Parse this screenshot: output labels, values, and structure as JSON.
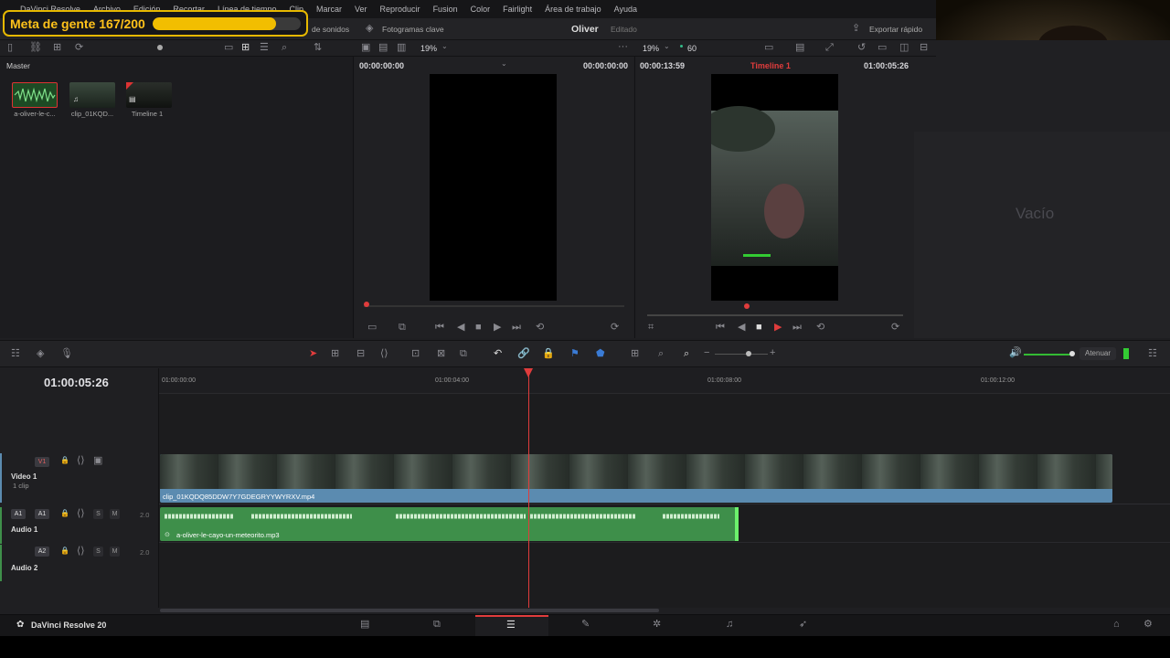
{
  "menu": {
    "items": [
      "DaVinci Resolve",
      "Archivo",
      "Edición",
      "Recortar",
      "Línea de tiempo",
      "Clip",
      "Marcar",
      "Ver",
      "Reproducir",
      "Fusion",
      "Color",
      "Fairlight",
      "Área de trabajo",
      "Ayuda"
    ]
  },
  "goal": {
    "label": "Meta de gente 167/200",
    "progress": 0.835
  },
  "toolbar": {
    "sounds_label": "de sonidos",
    "keyframes_label": "Fotogramas clave",
    "project_name": "Oliver",
    "project_status": "Editado",
    "export_label": "Exportar rápido"
  },
  "media_pool": {
    "title": "Master",
    "clips": [
      {
        "name": "a-oliver-le-c...",
        "type": "audio"
      },
      {
        "name": "clip_01KQD...",
        "type": "video"
      },
      {
        "name": "Timeline 1",
        "type": "timeline"
      }
    ]
  },
  "source_viewer": {
    "zoom": "19%",
    "tc_left": "00:00:00:00",
    "tc_right": "00:00:00:00"
  },
  "program_viewer": {
    "zoom": "19%",
    "fps": "60",
    "duration": "00:00:13:59",
    "timeline_name": "Timeline 1",
    "tc": "01:00:05:26"
  },
  "inspector": {
    "empty_label": "Vacío"
  },
  "timeline": {
    "current_tc": "01:00:05:26",
    "ruler": [
      "01:00:00:00",
      "01:00:04:00",
      "01:00:08:00",
      "01:00:12:00"
    ],
    "dim_label": "Atenuar",
    "tracks": [
      {
        "tag": "V1",
        "name": "Video 1",
        "sub": "1 clip",
        "clip": "clip_01KQDQ85DDW7Y7GDEGRYYWYRXV.mp4"
      },
      {
        "tag": "A1",
        "tag2": "A1",
        "name": "Audio 1",
        "level": "2.0",
        "clip": "a-oliver-le-cayo-un-meteorito.mp3"
      },
      {
        "tag": "A2",
        "name": "Audio 2",
        "level": "2.0"
      }
    ]
  },
  "app": {
    "name": "DaVinci Resolve 20"
  },
  "colors": {
    "accent": "#e6b800",
    "playhead": "#e03c3c",
    "audio": "#3e8f4a",
    "video": "#5b8bb0"
  }
}
